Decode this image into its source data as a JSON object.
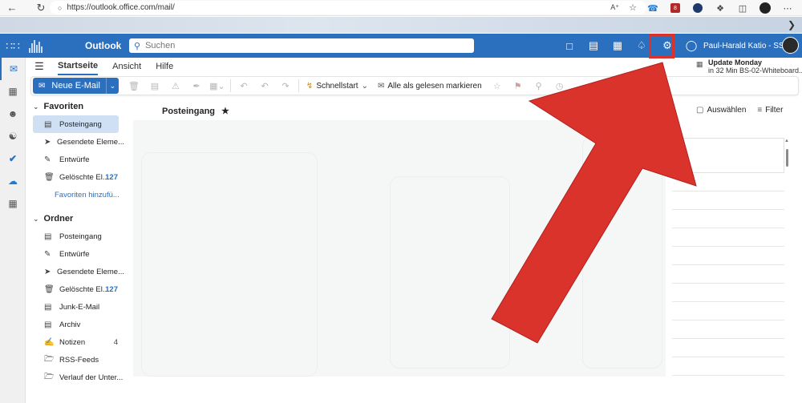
{
  "browser": {
    "url": "https://outlook.office.com/mail/",
    "icons": [
      "back-icon",
      "refresh-icon",
      "lock-icon",
      "read-aloud-icon",
      "favorite-icon",
      "phone-icon",
      "extension-icon",
      "shield-icon",
      "puzzle-icon",
      "split-screen-icon",
      "profile-icon",
      "more-icon"
    ]
  },
  "suite": {
    "app_name": "Outlook",
    "search_placeholder": "Suchen",
    "user_name": "Paul-Harald Katio - SSI...",
    "header_icons": [
      "teams-chat-icon",
      "word-icon",
      "my-day-icon",
      "bell-icon",
      "gear-icon",
      "lightbulb-icon"
    ]
  },
  "ribbon": {
    "tabs": [
      "Startseite",
      "Ansicht",
      "Hilfe"
    ],
    "active_tab": "Startseite"
  },
  "notification": {
    "title": "Update Monday",
    "subtitle": "in 32 Min BS-02-Whiteboard..."
  },
  "commands": {
    "new_mail": "Neue E-Mail",
    "quick_steps": "Schnellstart",
    "mark_all_read": "Alle als gelesen markieren"
  },
  "folders": {
    "favorites_label": "Favoriten",
    "favorites": [
      {
        "label": "Posteingang",
        "icon": "inbox-icon",
        "count": ""
      },
      {
        "label": "Gesendete Eleme...",
        "icon": "send-icon",
        "count": ""
      },
      {
        "label": "Entwürfe",
        "icon": "draft-icon",
        "count": ""
      },
      {
        "label": "Gelöschte El...",
        "icon": "trash-icon",
        "count": "127"
      }
    ],
    "add_favorite": "Favoriten hinzufü...",
    "folders_label": "Ordner",
    "folders": [
      {
        "label": "Posteingang",
        "icon": "inbox-icon",
        "count": ""
      },
      {
        "label": "Entwürfe",
        "icon": "draft-icon",
        "count": ""
      },
      {
        "label": "Gesendete Eleme...",
        "icon": "send-icon",
        "count": ""
      },
      {
        "label": "Gelöschte El...",
        "icon": "trash-icon",
        "count": "127"
      },
      {
        "label": "Junk-E-Mail",
        "icon": "junk-icon",
        "count": ""
      },
      {
        "label": "Archiv",
        "icon": "archive-icon",
        "count": ""
      },
      {
        "label": "Notizen",
        "icon": "notes-icon",
        "count": "4"
      },
      {
        "label": "RSS-Feeds",
        "icon": "folder-icon",
        "count": ""
      },
      {
        "label": "Verlauf der Unter...",
        "icon": "folder-icon",
        "count": ""
      }
    ]
  },
  "message_list": {
    "title": "Posteingang",
    "select_label": "Auswählen",
    "filter_label": "Filter"
  },
  "colors": {
    "brand": "#2b6fbf",
    "highlight": "#d9332b",
    "selected_folder": "#cfe0f5"
  }
}
